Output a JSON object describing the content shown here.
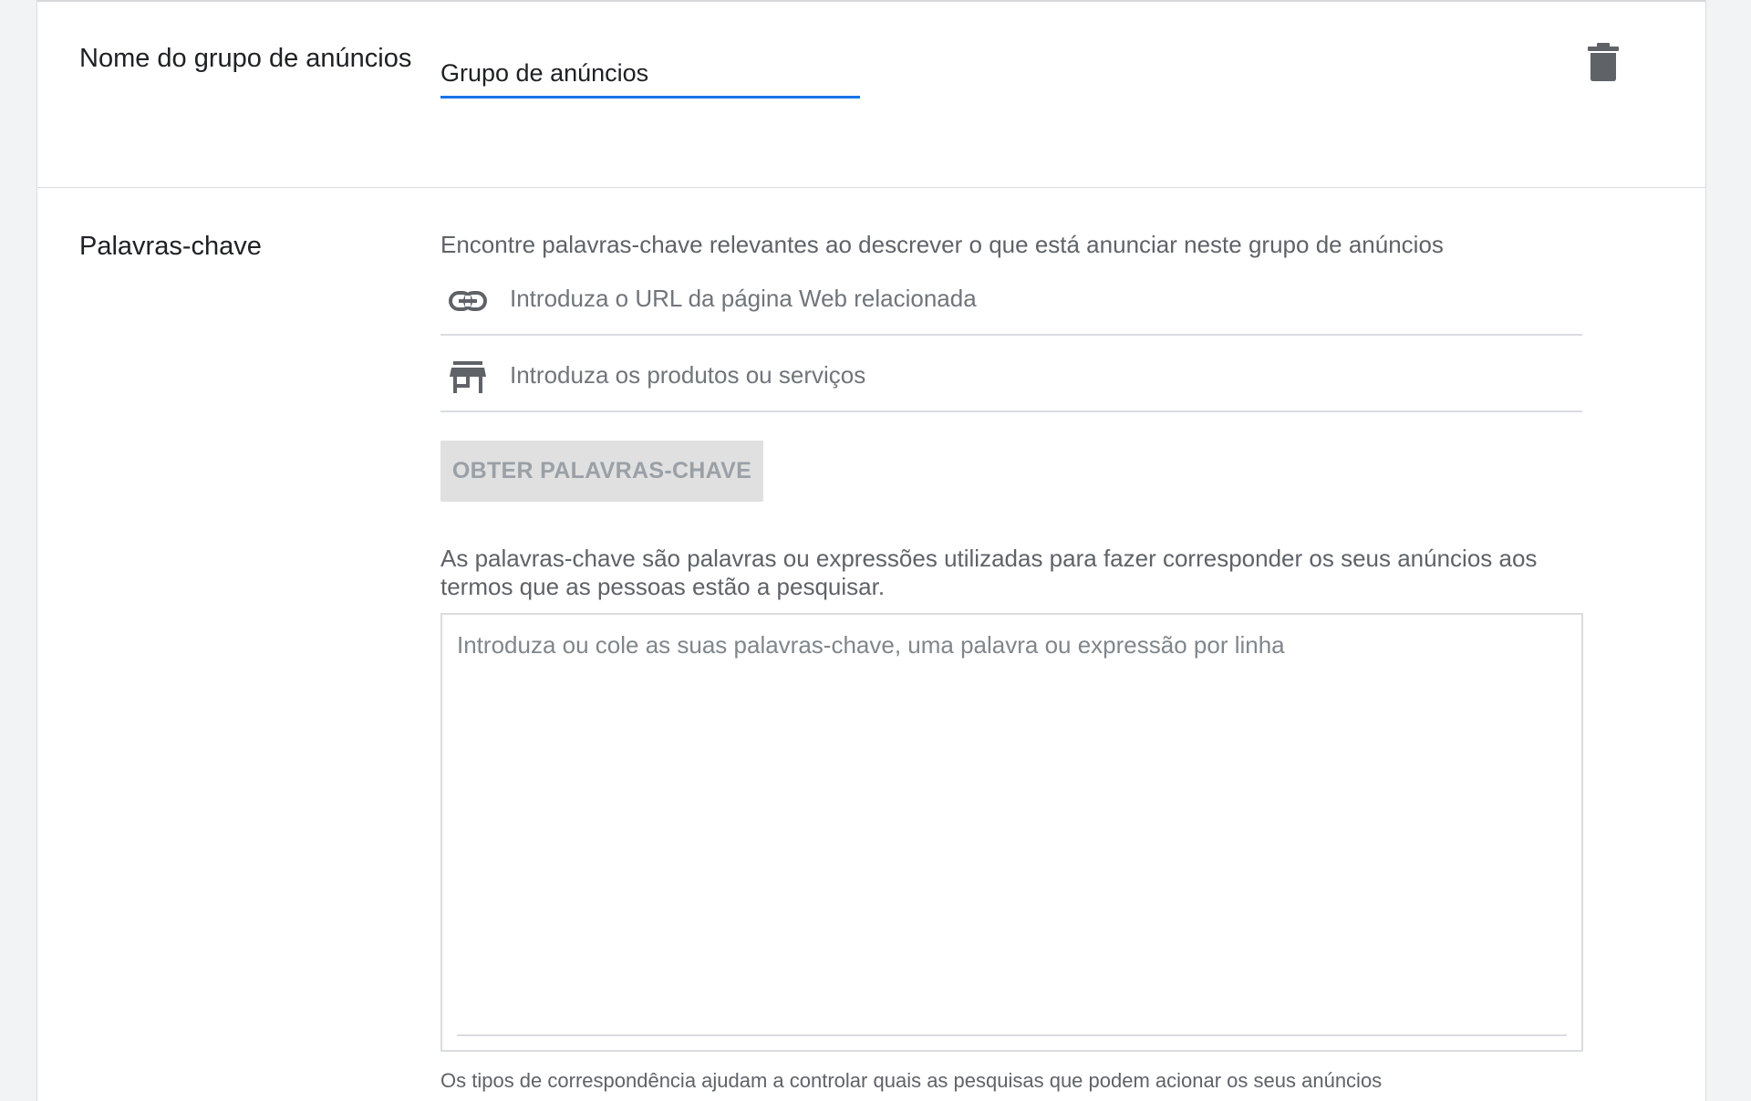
{
  "ad_group": {
    "name_label": "Nome do grupo de anúncios",
    "name_value": "Grupo de anúncios"
  },
  "keywords": {
    "section_label": "Palavras-chave",
    "description": "Encontre palavras-chave relevantes ao descrever o que está anunciar neste grupo de anúncios",
    "url_placeholder": "Introduza o URL da página Web relacionada",
    "products_placeholder": "Introduza os produtos ou serviços",
    "get_keywords_button": "OBTER PALAVRAS-CHAVE",
    "info_text": "As palavras-chave são palavras ou expressões utilizadas para fazer corresponder os seus anúncios aos termos que as pessoas estão a pesquisar.",
    "textarea_placeholder": "Introduza ou cole as suas palavras-chave, uma palavra ou expressão por linha",
    "match_types_note": "Os tipos de correspondência ajudam a controlar quais as pesquisas que podem acionar os seus anúncios"
  },
  "icons": {
    "delete": "trash-icon",
    "url": "link-icon",
    "products": "store-icon"
  },
  "colors": {
    "accent": "#1a73e8",
    "text_primary": "#202124",
    "text_secondary": "#5f6368",
    "divider": "#dadce0",
    "disabled_button": "#e0e0e0"
  }
}
